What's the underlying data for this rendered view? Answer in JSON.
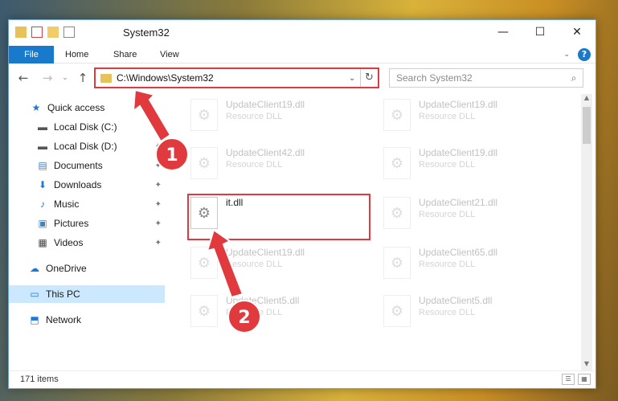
{
  "window": {
    "title": "System32",
    "controls": {
      "minimize": "—",
      "maximize": "☐",
      "close": "✕"
    }
  },
  "ribbon": {
    "tabs": [
      "File",
      "Home",
      "Share",
      "View"
    ],
    "help": "?"
  },
  "nav": {
    "back": "←",
    "forward": "→",
    "up": "↑",
    "address": "C:\\Windows\\System32",
    "refresh": "↻",
    "search_placeholder": "Search System32"
  },
  "sidebar": {
    "items": [
      {
        "label": "Quick access",
        "icon": "star-icon",
        "glyph": "★",
        "color": "#1e78d7"
      },
      {
        "label": "Local Disk (C:)",
        "icon": "drive-icon",
        "glyph": "▬",
        "color": "#555",
        "pinned": true
      },
      {
        "label": "Local Disk (D:)",
        "icon": "drive-icon",
        "glyph": "▬",
        "color": "#555",
        "pinned": true
      },
      {
        "label": "Documents",
        "icon": "documents-icon",
        "glyph": "▤",
        "color": "#4a7fb5",
        "pinned": true
      },
      {
        "label": "Downloads",
        "icon": "downloads-icon",
        "glyph": "⬇",
        "color": "#1e78d7",
        "pinned": true
      },
      {
        "label": "Music",
        "icon": "music-icon",
        "glyph": "♪",
        "color": "#1e78d7",
        "pinned": true
      },
      {
        "label": "Pictures",
        "icon": "pictures-icon",
        "glyph": "▣",
        "color": "#4a7fb5",
        "pinned": true
      },
      {
        "label": "Videos",
        "icon": "videos-icon",
        "glyph": "▦",
        "color": "#444",
        "pinned": true
      },
      {
        "label": "OneDrive",
        "icon": "onedrive-icon",
        "glyph": "☁",
        "color": "#1e78d7"
      },
      {
        "label": "This PC",
        "icon": "computer-icon",
        "glyph": "▭",
        "color": "#1e78d7",
        "selected": true
      },
      {
        "label": "Network",
        "icon": "network-icon",
        "glyph": "⬒",
        "color": "#1e78d7"
      }
    ],
    "pin_glyph": "📌"
  },
  "files": [
    {
      "name": "UpdateClient19.dll",
      "desc": "Resource DLL",
      "faded": true
    },
    {
      "name": "UpdateClient19.dll",
      "desc": "Resource DLL",
      "faded": true
    },
    {
      "name": "UpdateClient42.dll",
      "desc": "Resource DLL",
      "faded": true
    },
    {
      "name": "UpdateClient19.dll",
      "desc": "Resource DLL",
      "faded": true
    },
    {
      "name": "it.dll",
      "desc": "",
      "faded": false
    },
    {
      "name": "UpdateClient21.dll",
      "desc": "Resource DLL",
      "faded": true
    },
    {
      "name": "UpdateClient19.dll",
      "desc": "Resource DLL",
      "faded": true
    },
    {
      "name": "UpdateClient65.dll",
      "desc": "Resource DLL",
      "faded": true
    },
    {
      "name": "UpdateClient5.dll",
      "desc": "Resource DLL",
      "faded": true
    },
    {
      "name": "UpdateClient5.dll",
      "desc": "Resource DLL",
      "faded": true
    }
  ],
  "status": {
    "item_count": "171 items"
  },
  "annotations": {
    "step1": "1",
    "step2": "2",
    "color": "#e0393e"
  }
}
